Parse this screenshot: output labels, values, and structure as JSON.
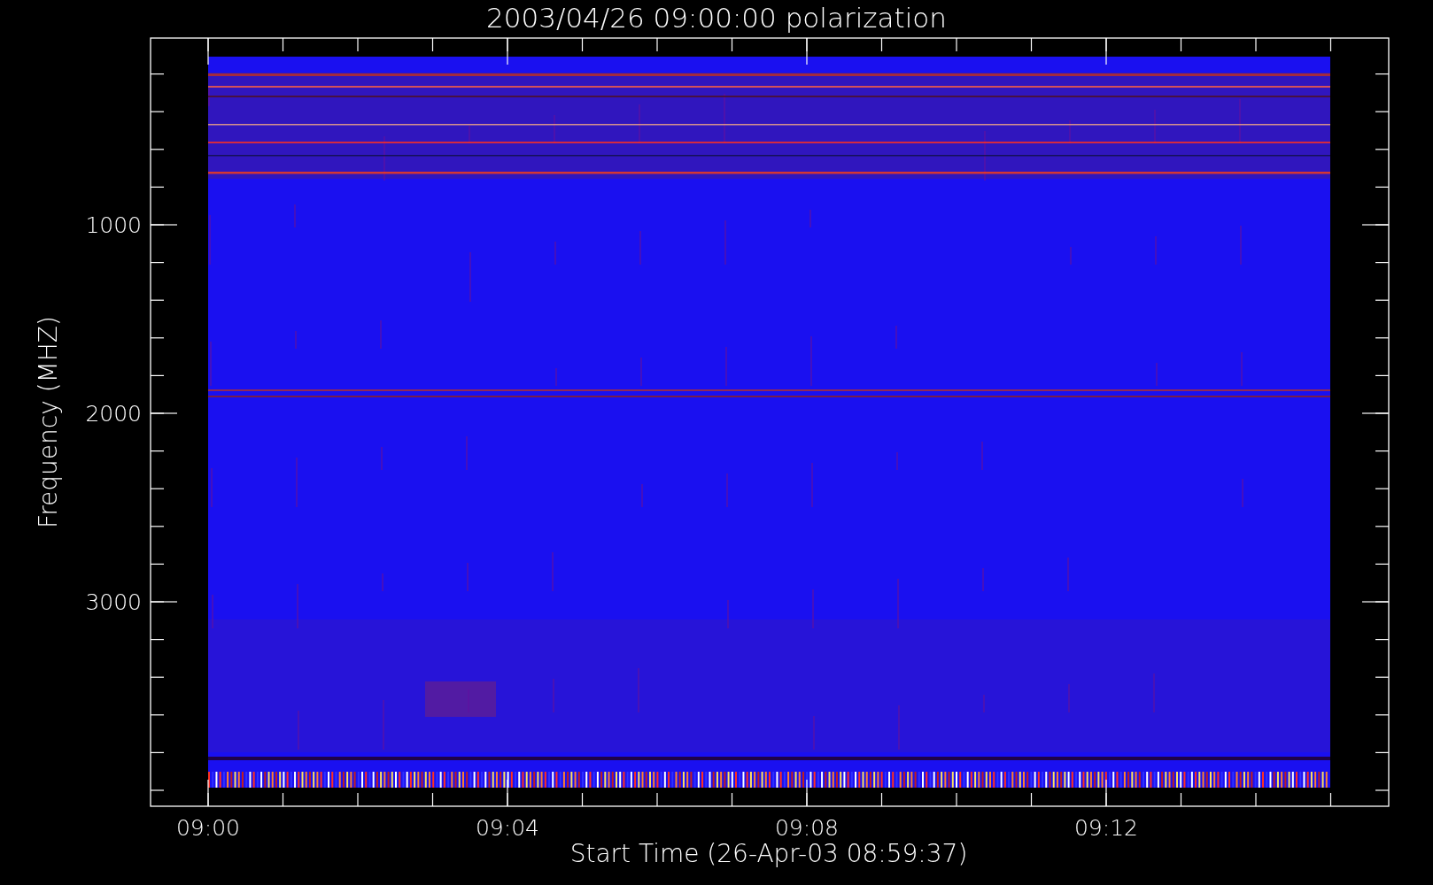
{
  "title": "2003/04/26 09:00:00 polarization",
  "y_axis": {
    "label": "Frequency (MHZ)",
    "tick_labels": [
      "1000",
      "2000",
      "3000"
    ]
  },
  "x_axis": {
    "label": "Start Time (26-Apr-03 08:59:37)",
    "tick_labels": [
      "09:00",
      "09:04",
      "09:08",
      "09:12"
    ]
  }
}
